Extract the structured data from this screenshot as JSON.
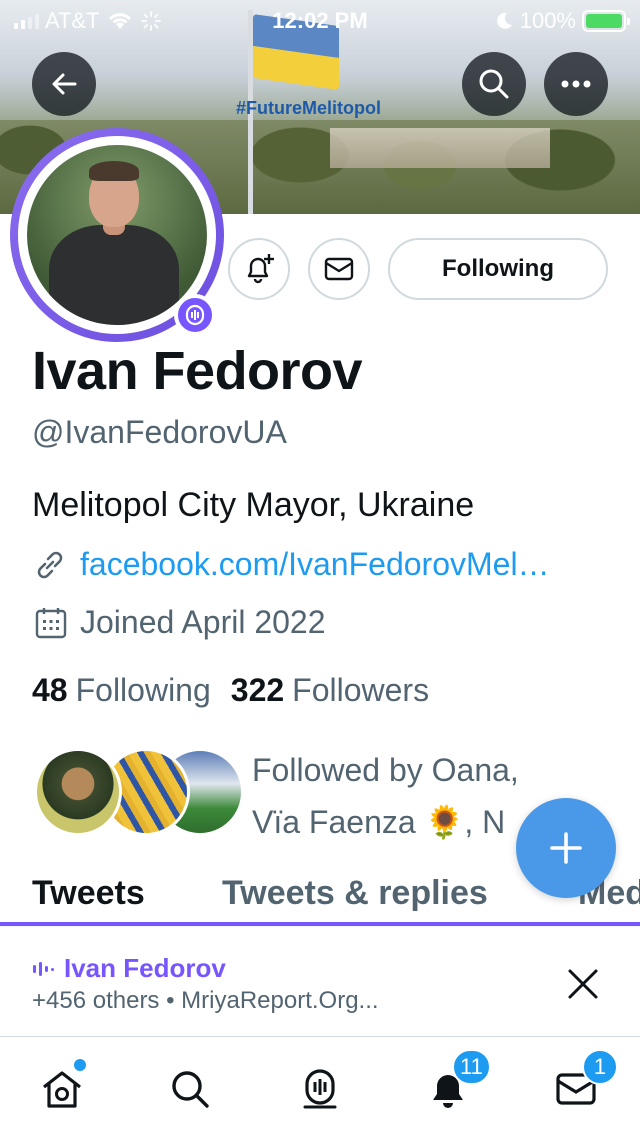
{
  "status_bar": {
    "carrier": "AT&T",
    "time": "12:02 PM",
    "battery": "100%"
  },
  "banner": {
    "hashtag": "#FutureMelitopol"
  },
  "profile": {
    "name": "Ivan Fedorov",
    "handle": "@IvanFedorovUA",
    "bio": "Melitopol City Mayor, Ukraine",
    "link": "facebook.com/IvanFedorovMel…",
    "joined": "Joined April 2022",
    "following_count": "48",
    "following_label": "Following",
    "followers_count": "322",
    "followers_label": "Followers"
  },
  "actions": {
    "follow_button": "Following"
  },
  "followed_by": {
    "line1": "Followed by Oana,",
    "line2": "Vïa Faenza 🌻, N"
  },
  "tabs": [
    {
      "label": "Tweets",
      "active": true
    },
    {
      "label": "Tweets & replies",
      "active": false
    },
    {
      "label": "Med",
      "active": false
    }
  ],
  "spaces": {
    "host": "Ivan Fedorov",
    "meta": "+456 others • MriyaReport.Org..."
  },
  "bottom_nav": {
    "notifications_badge": "11",
    "messages_badge": "1"
  },
  "colors": {
    "accent": "#1d9bf0",
    "spaces_purple": "#7856ff",
    "text_primary": "#0f1419",
    "text_secondary": "#536471"
  }
}
